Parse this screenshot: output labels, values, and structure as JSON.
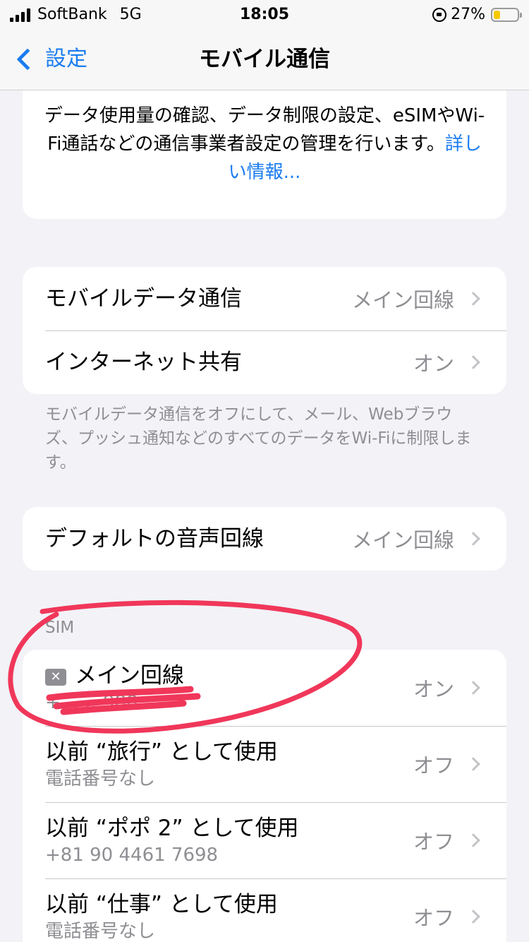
{
  "status_bar": {
    "carrier": "SoftBank",
    "network": "5G",
    "time": "18:05",
    "battery_percent": "27%",
    "battery_level": 0.27,
    "battery_color": "#f6c900"
  },
  "nav": {
    "back_label": "設定",
    "title": "モバイル通信"
  },
  "intro": {
    "text": "データ使用量の確認、データ制限の設定、eSIMやWi-Fi通話などの通信事業者設定の管理を行います。",
    "link": "詳しい情報..."
  },
  "data_group": {
    "items": [
      {
        "label": "モバイルデータ通信",
        "value": "メイン回線"
      },
      {
        "label": "インターネット共有",
        "value": "オン"
      }
    ],
    "footnote": "モバイルデータ通信をオフにして、メール、Webブラウズ、プッシュ通知などのすべてのデータをWi-Fiに制限します。"
  },
  "voice_group": {
    "items": [
      {
        "label": "デフォルトの音声回線",
        "value": "メイン回線"
      }
    ]
  },
  "sim_section": {
    "header": "SIM",
    "items": [
      {
        "label": "メイン回線",
        "sub": "+… …988",
        "value": "オン",
        "icon": "sim-card-icon"
      },
      {
        "label": "以前 “旅行” として使用",
        "sub": "電話番号なし",
        "value": "オフ"
      },
      {
        "label": "以前 “ポポ 2” として使用",
        "sub": "+81 90 4461 7698",
        "value": "オフ"
      },
      {
        "label": "以前 “仕事” として使用",
        "sub": "電話番号なし",
        "value": "オフ"
      }
    ]
  },
  "colors": {
    "accent": "#1a7cf0",
    "annotation": "#f0375a",
    "secondary_text": "#8e8e93"
  }
}
